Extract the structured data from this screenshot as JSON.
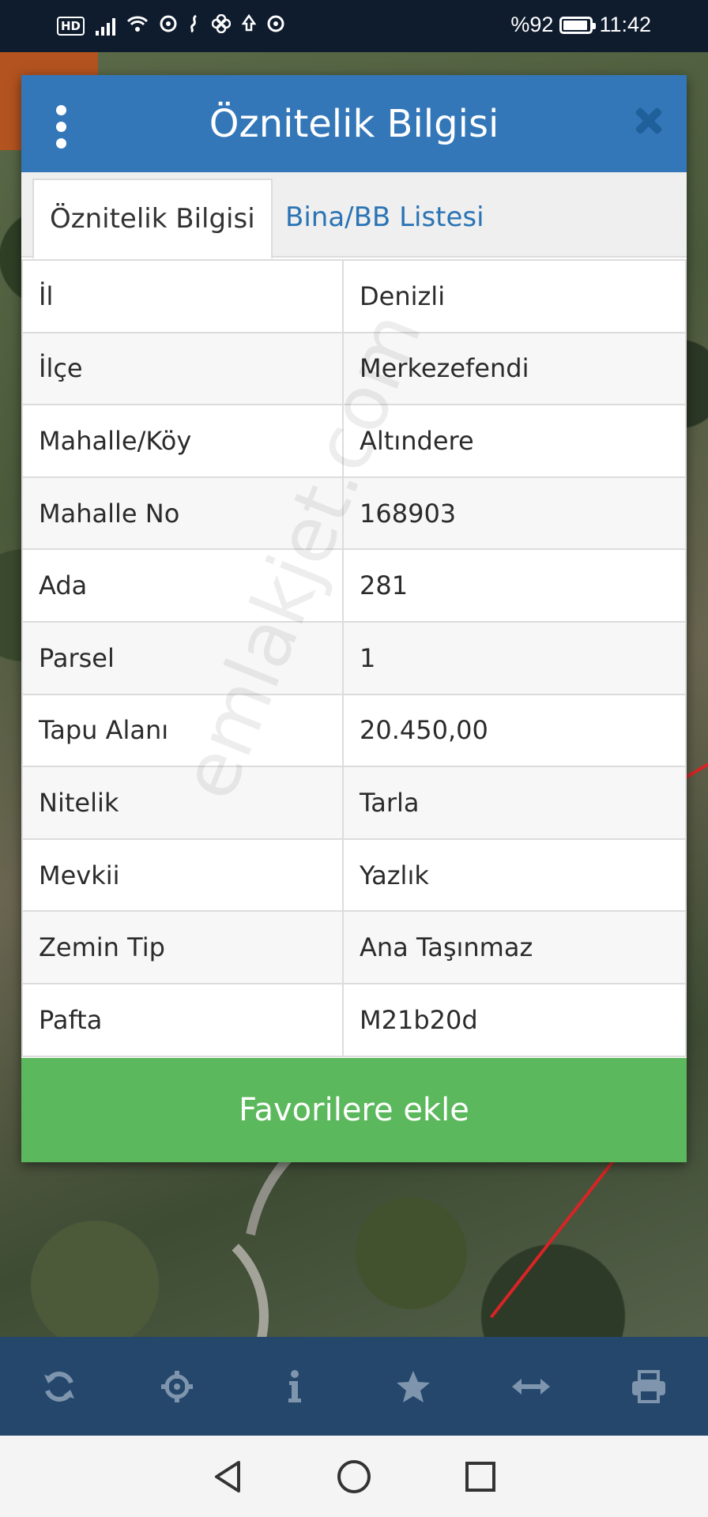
{
  "status_bar": {
    "battery": "%92",
    "time": "11:42",
    "battery_level": 0.92,
    "left_badge": "HD"
  },
  "dialog": {
    "title": "Öznitelik Bilgisi",
    "tabs": [
      {
        "label": "Öznitelik Bilgisi",
        "active": true
      },
      {
        "label": "Bina/BB Listesi",
        "active": false
      }
    ],
    "rows": [
      {
        "key": "İl",
        "value": "Denizli"
      },
      {
        "key": "İlçe",
        "value": "Merkezefendi"
      },
      {
        "key": "Mahalle/Köy",
        "value": "Altındere"
      },
      {
        "key": "Mahalle No",
        "value": "168903"
      },
      {
        "key": "Ada",
        "value": "281"
      },
      {
        "key": "Parsel",
        "value": "1"
      },
      {
        "key": "Tapu Alanı",
        "value": "20.450,00"
      },
      {
        "key": "Nitelik",
        "value": "Tarla"
      },
      {
        "key": "Mevkii",
        "value": "Yazlık"
      },
      {
        "key": "Zemin Tip",
        "value": "Ana Taşınmaz"
      },
      {
        "key": "Pafta",
        "value": "M21b20d"
      }
    ],
    "favorite_button": "Favorilere ekle"
  },
  "watermark": "emlakjet.com",
  "toolbar": {
    "icons": [
      "refresh-icon",
      "locate-icon",
      "info-icon",
      "star-icon",
      "measure-icon",
      "print-icon"
    ]
  },
  "colors": {
    "header": "#3477b8",
    "favorite": "#5cb85c",
    "toolbar": "#24476b",
    "tab_link": "#2a74b5"
  }
}
